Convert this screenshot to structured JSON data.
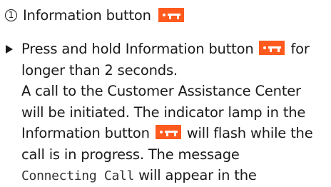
{
  "heading": {
    "callout_number": "1",
    "label": "Information button",
    "icon": "information-button-icon"
  },
  "step": {
    "line1_before_icon": "Press and hold Information button",
    "line1_after_icon": "for",
    "line2": "longer than 2 seconds.",
    "line3": "A call to the Customer Assistance Center",
    "line4": "will be initiated. The indicator lamp in the",
    "line5_before_icon": "Information button",
    "line5_after_icon": "will flash while the",
    "line6": "call is in progress. The message",
    "line7_display_message": "Connecting Call",
    "line7_after": "will appear in the"
  },
  "colors": {
    "icon_background": "#ff5a1e",
    "text": "#1a1a1a"
  }
}
